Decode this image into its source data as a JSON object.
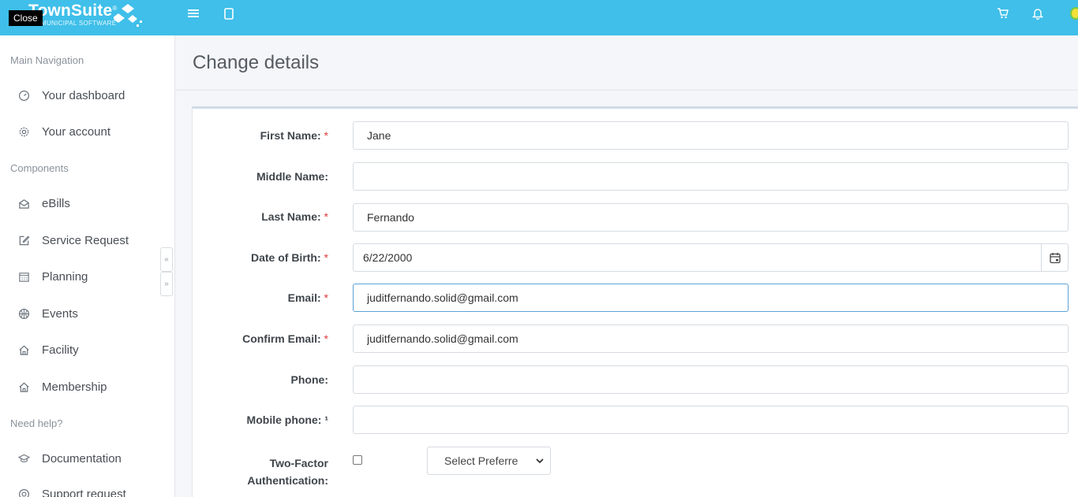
{
  "topbar": {
    "brand_name": "TownSuite",
    "brand_reg": "®",
    "brand_sub": "MUNICIPAL SOFTWARE",
    "close_tooltip": "Close",
    "icons": [
      "menu-icon",
      "panel-icon",
      "cart-icon",
      "bell-icon",
      "avatar"
    ],
    "accent_color": "#3fbfe9"
  },
  "sidebar": {
    "sections": [
      {
        "header": "Main Navigation",
        "items": [
          {
            "label": "Your dashboard",
            "icon": "dashboard-icon"
          },
          {
            "label": "Your account",
            "icon": "gear-icon"
          }
        ]
      },
      {
        "header": "Components",
        "items": [
          {
            "label": "eBills",
            "icon": "envelope-open-icon"
          },
          {
            "label": "Service Request",
            "icon": "edit-icon"
          },
          {
            "label": "Planning",
            "icon": "calendar-grid-icon"
          },
          {
            "label": "Events",
            "icon": "basketball-icon"
          },
          {
            "label": "Facility",
            "icon": "home-icon"
          },
          {
            "label": "Membership",
            "icon": "home-icon"
          }
        ]
      },
      {
        "header": "Need help?",
        "items": [
          {
            "label": "Documentation",
            "icon": "graduation-cap-icon"
          },
          {
            "label": "Support request",
            "icon": "lifebuoy-icon"
          }
        ]
      }
    ]
  },
  "page": {
    "title": "Change details"
  },
  "form": {
    "first_name": {
      "label": "First Name:",
      "required": "*",
      "value": "Jane"
    },
    "middle_name": {
      "label": "Middle Name:",
      "value": ""
    },
    "last_name": {
      "label": "Last Name:",
      "required": "*",
      "value": "Fernando"
    },
    "dob": {
      "label": "Date of Birth:",
      "required": "*",
      "value": "6/22/2000"
    },
    "email": {
      "label": "Email:",
      "required": "*",
      "value": "juditfernando.solid@gmail.com"
    },
    "confirm_email": {
      "label": "Confirm Email:",
      "required": "*",
      "value": "juditfernando.solid@gmail.com"
    },
    "phone": {
      "label": "Phone:",
      "value": ""
    },
    "mobile": {
      "label": "Mobile phone:",
      "marker": "¹",
      "value": ""
    },
    "two_factor": {
      "label_line1": "Two-Factor",
      "label_line2": "Authentication:",
      "checked": false,
      "select_value": "Select Preferre"
    }
  }
}
